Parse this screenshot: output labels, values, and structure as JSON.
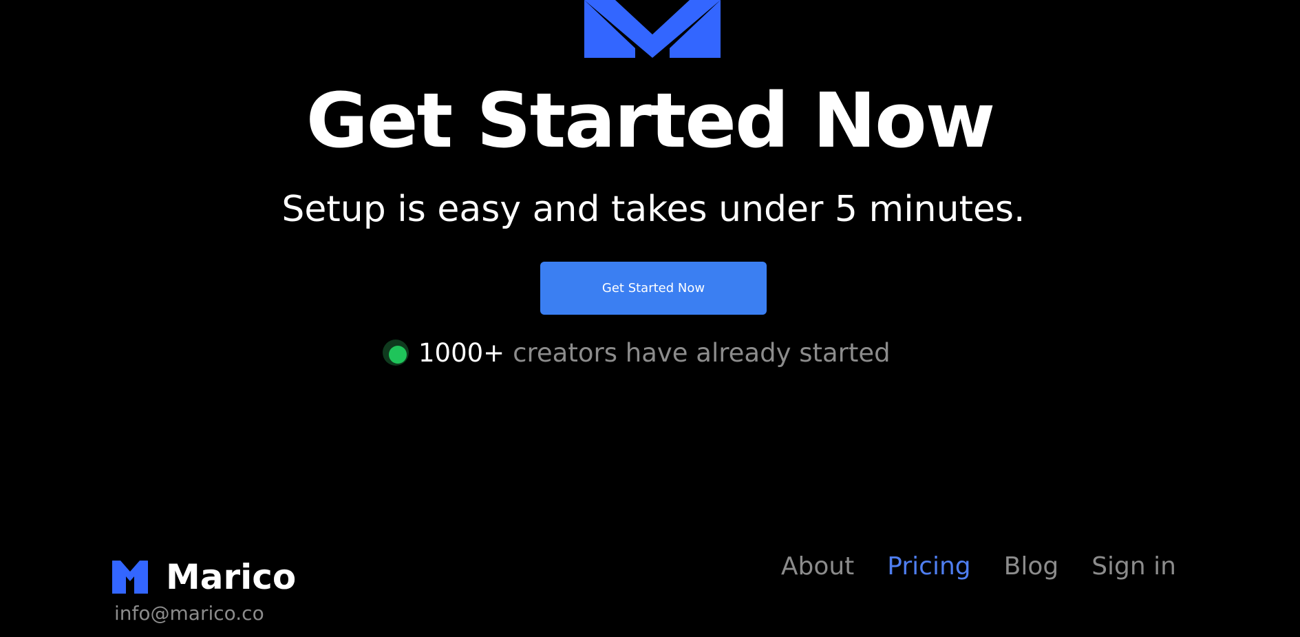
{
  "colors": {
    "background": "#000000",
    "accent": "#3b7ff2",
    "logo": "#3366ff",
    "status_green": "#1fc45a",
    "muted_text": "#8c8c8c",
    "active_link": "#4f7ef0"
  },
  "hero": {
    "logo_icon": "marico-m-logo-icon",
    "title": "Get Started Now",
    "subtitle": "Setup is easy and takes under 5 minutes.",
    "cta_label": "Get Started Now",
    "social_proof": {
      "status_icon": "green-status-dot-icon",
      "count": "1000+",
      "suffix": "creators have already started"
    }
  },
  "footer": {
    "logo_icon": "marico-m-logo-icon",
    "brand": "Marico",
    "email": "info@marico.co",
    "nav": [
      {
        "label": "About",
        "active": false
      },
      {
        "label": "Pricing",
        "active": true
      },
      {
        "label": "Blog",
        "active": false
      },
      {
        "label": "Sign in",
        "active": false
      }
    ]
  }
}
